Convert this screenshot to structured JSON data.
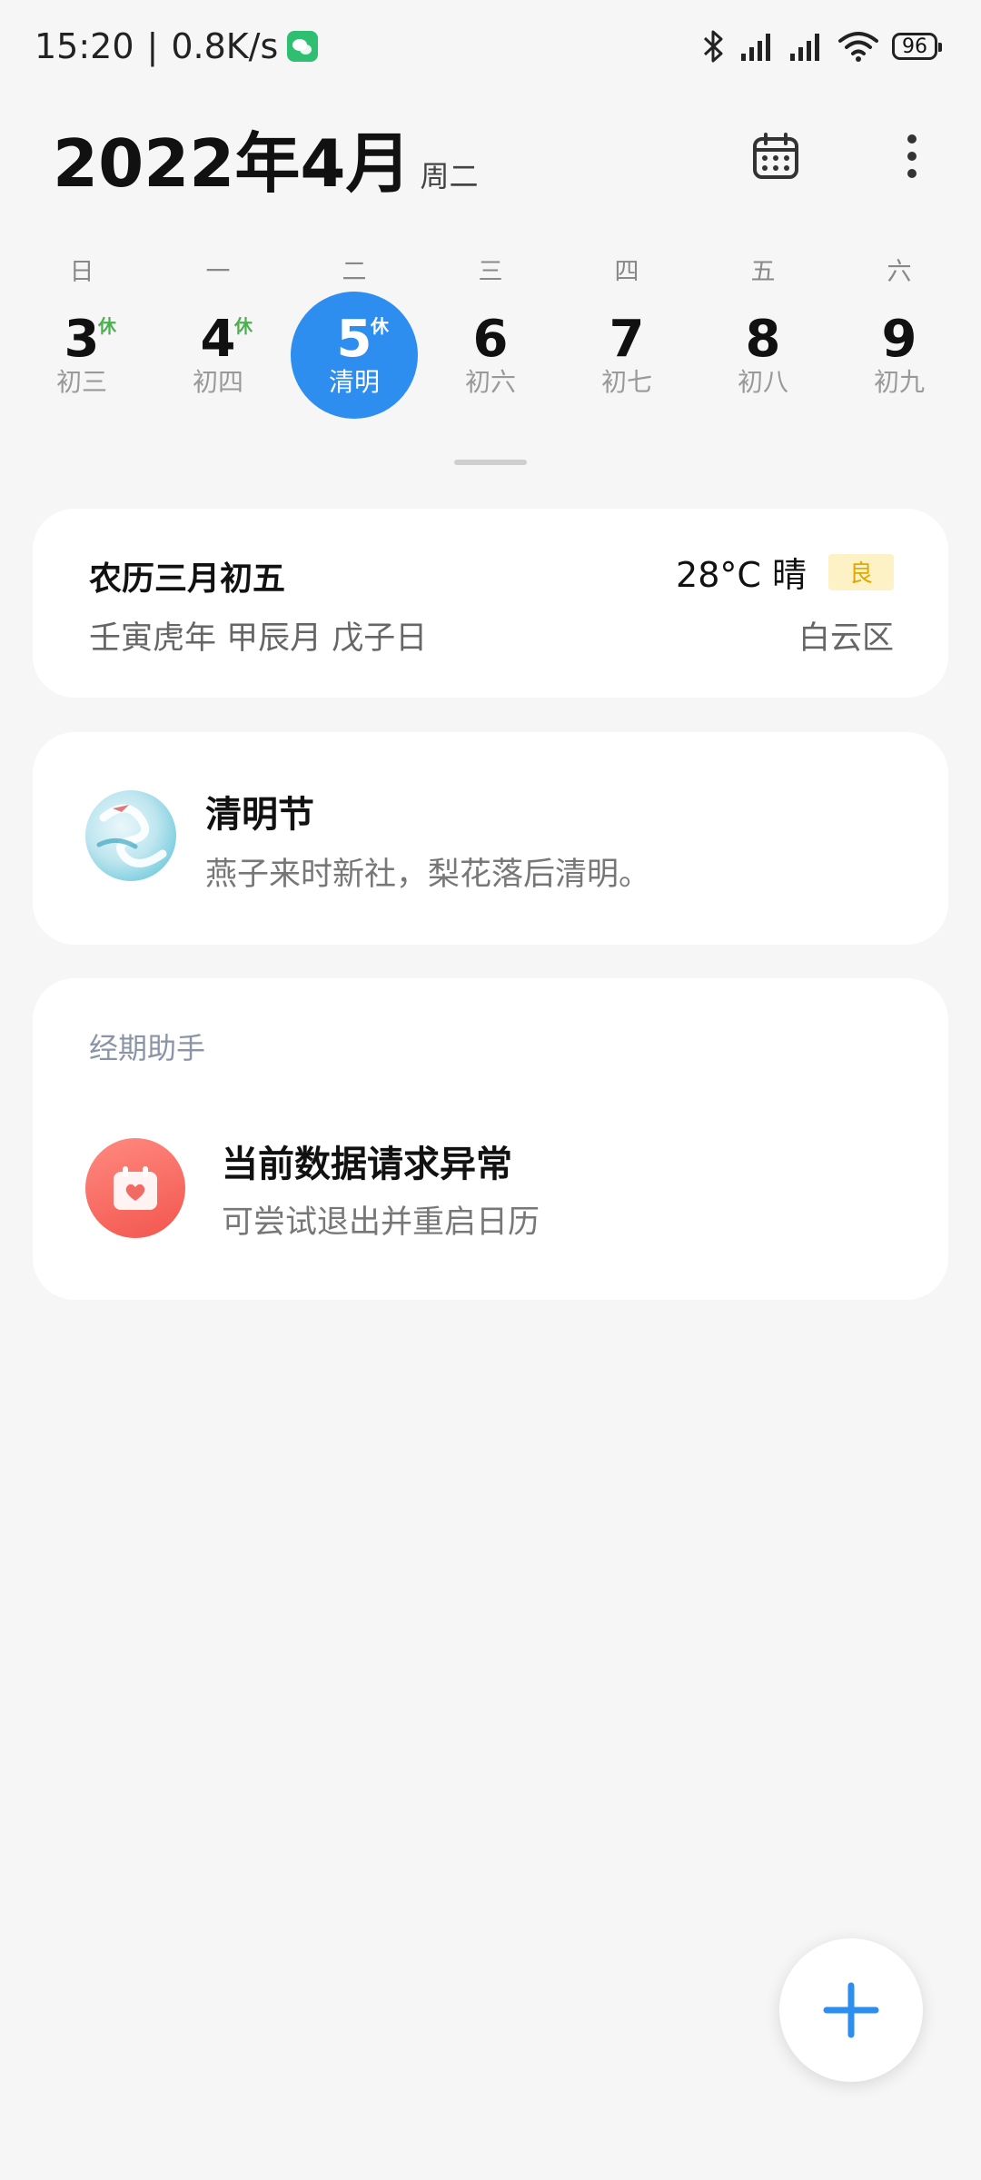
{
  "status_bar": {
    "time": "15:20",
    "separator": "|",
    "net_speed": "0.8K/s",
    "battery": "96",
    "icons": [
      "wechat-icon",
      "bluetooth-icon",
      "signal-icon",
      "signal-icon",
      "wifi-icon",
      "battery-icon"
    ]
  },
  "header": {
    "title": "2022年4月",
    "weekday": "周二"
  },
  "week": {
    "days": [
      {
        "weekday": "日",
        "num": "3",
        "lunar": "初三",
        "rest": "休",
        "selected": false
      },
      {
        "weekday": "一",
        "num": "4",
        "lunar": "初四",
        "rest": "休",
        "selected": false
      },
      {
        "weekday": "二",
        "num": "5",
        "lunar": "清明",
        "rest": "休",
        "selected": true
      },
      {
        "weekday": "三",
        "num": "6",
        "lunar": "初六",
        "rest": "",
        "selected": false
      },
      {
        "weekday": "四",
        "num": "7",
        "lunar": "初七",
        "rest": "",
        "selected": false
      },
      {
        "weekday": "五",
        "num": "8",
        "lunar": "初八",
        "rest": "",
        "selected": false
      },
      {
        "weekday": "六",
        "num": "9",
        "lunar": "初九",
        "rest": "",
        "selected": false
      }
    ]
  },
  "lunar_card": {
    "lunar_date": "农历三月初五",
    "ganzhi": "壬寅虎年 甲辰月 戊子日",
    "weather": "28°C 晴",
    "aqi": "良",
    "district": "白云区"
  },
  "festival_card": {
    "title": "清明节",
    "poem": "燕子来时新社，梨花落后清明。"
  },
  "period_card": {
    "section": "经期助手",
    "title": "当前数据请求异常",
    "subtitle": "可尝试退出并重启日历"
  },
  "colors": {
    "accent": "#2e8ef0",
    "rest_green": "#4caf50",
    "aqi_bg": "#fdf2c6",
    "aqi_text": "#e0a800",
    "period_red": "#f2564e"
  }
}
